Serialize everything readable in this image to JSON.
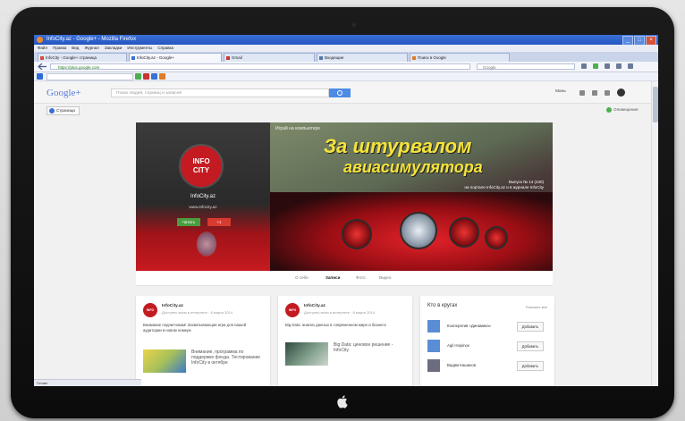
{
  "browser": {
    "title": "InfoCity.az - Google+ - Mozilla Firefox",
    "menu": [
      "Файл",
      "Правка",
      "Вид",
      "Журнал",
      "Закладки",
      "Инструменты",
      "Справка"
    ],
    "tabs": [
      {
        "label": "InfoCity - Google+ страница"
      },
      {
        "label": "InfoCity.az - Google+"
      },
      {
        "label": "Gmail"
      },
      {
        "label": "Входящие"
      },
      {
        "label": "Поиск в Google"
      }
    ],
    "url": "https://plus.google.com",
    "search_placeholder": "Google",
    "status": "Готово"
  },
  "gplus": {
    "logo": "Google+",
    "search_placeholder": "Поиск людей, страниц и записей",
    "user": "Мань",
    "page_selector": "Страница",
    "notifications": "Оповещения"
  },
  "cover": {
    "kicker": "Играй на компьютере",
    "headline_line1": "За штурвалом",
    "headline_line2": "авиасимулятора",
    "issue_line1": "Выпуск № 14 (430)",
    "issue_line2": "на портале InfoCity.az и в журнале InfoCity"
  },
  "profile": {
    "logo_line1": "INFO",
    "logo_line2": "CITY",
    "name": "InfoCity.az",
    "site": "www.infocity.az",
    "follow_label": "Читать",
    "message_label": "+1",
    "tabs": [
      "О себе",
      "Записи",
      "Фото",
      "Видео"
    ],
    "active_tab": "Записи"
  },
  "posts": [
    {
      "name": "InfoCity.az",
      "meta": "Доступно всем в интернете · 8 марта 2014",
      "text": "Внимание подписчикам! Захватывающая игра для нашей аудитории в новом номере",
      "link": "Внимание, программа по поддержке фонда. Тестирование InfoCity в октябре",
      "thumb_color": "#e8d44a"
    },
    {
      "name": "InfoCity.az",
      "meta": "Доступно всем в интернете · 8 марта 2014",
      "text": "Big Data: анализ данных в современном мире и бизнесе",
      "link": "Big Data: ценовое решение - InfoCity",
      "thumb_color": "#5c7a6a"
    }
  ],
  "sidebar": {
    "title": "Кто в кругах",
    "all_link": "Показать все",
    "add_label": "Добавить",
    "people": [
      {
        "name": "Кооператив «Динамика»"
      },
      {
        "name": "Aqil Həşimov"
      },
      {
        "name": "Вадим Кашанов"
      }
    ]
  },
  "colors": {
    "accent": "#c41b22",
    "google_blue": "#4d8be6",
    "headline_yellow": "#f5e33a"
  }
}
